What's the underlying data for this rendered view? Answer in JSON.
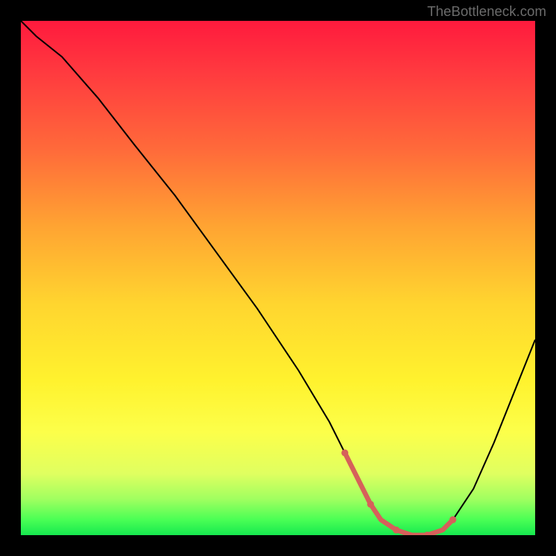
{
  "watermark": "TheBottleneck.com",
  "chart_data": {
    "type": "line",
    "title": "",
    "xlabel": "",
    "ylabel": "",
    "xlim": [
      0,
      100
    ],
    "ylim": [
      0,
      100
    ],
    "series": [
      {
        "name": "main-curve",
        "color": "#000000",
        "x": [
          0,
          3,
          8,
          15,
          22,
          30,
          38,
          46,
          54,
          60,
          63,
          66,
          68,
          70,
          73,
          76,
          79,
          82,
          84,
          88,
          92,
          96,
          100
        ],
        "y": [
          100,
          97,
          93,
          85,
          76,
          66,
          55,
          44,
          32,
          22,
          16,
          10,
          6,
          3,
          1,
          0,
          0,
          1,
          3,
          9,
          18,
          28,
          38
        ]
      },
      {
        "name": "highlight-segment",
        "color": "#d6605a",
        "x": [
          63,
          66,
          68,
          70,
          73,
          76,
          79,
          82,
          84
        ],
        "y": [
          16,
          10,
          6,
          3,
          1,
          0,
          0,
          1,
          3
        ]
      }
    ],
    "grid": false,
    "legend": false
  }
}
